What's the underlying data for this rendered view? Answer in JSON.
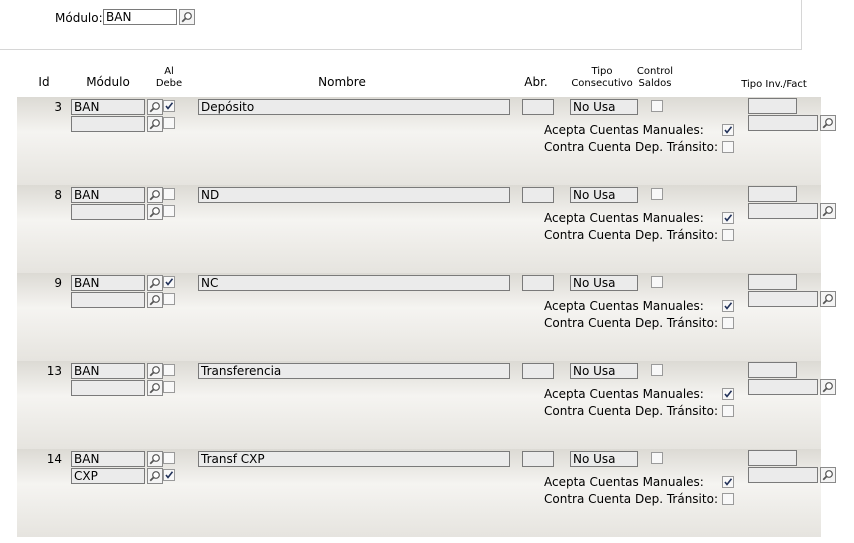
{
  "filter": {
    "module_label": "Módulo:",
    "module_value": "BAN"
  },
  "headers": {
    "id": "Id",
    "modulo": "Módulo",
    "al_debe_1": "Al",
    "al_debe_2": "Debe",
    "nombre": "Nombre",
    "abr": "Abr.",
    "tipo_consec_1": "Tipo",
    "tipo_consec_2": "Consecutivo",
    "control_saldos_1": "Control",
    "control_saldos_2": "Saldos",
    "tipo_inv_fact": "Tipo Inv./Fact"
  },
  "labels": {
    "acepta_cuentas_manuales": "Acepta Cuentas Manuales:",
    "contra_cuenta_dep_transito": "Contra Cuenta Dep. Tránsito:"
  },
  "rows": [
    {
      "id": "3",
      "modulo1": "BAN",
      "modulo2": "",
      "al_debe1": true,
      "al_debe2": false,
      "nombre": "Depósito",
      "abr": "",
      "tipo_consecutivo": "No Usa",
      "control_saldos": false,
      "acepta_manuales": true,
      "contra_cuenta": false
    },
    {
      "id": "8",
      "modulo1": "BAN",
      "modulo2": "",
      "al_debe1": false,
      "al_debe2": false,
      "nombre": "ND",
      "abr": "",
      "tipo_consecutivo": "No Usa",
      "control_saldos": false,
      "acepta_manuales": true,
      "contra_cuenta": false
    },
    {
      "id": "9",
      "modulo1": "BAN",
      "modulo2": "",
      "al_debe1": true,
      "al_debe2": false,
      "nombre": "NC",
      "abr": "",
      "tipo_consecutivo": "No Usa",
      "control_saldos": false,
      "acepta_manuales": true,
      "contra_cuenta": false
    },
    {
      "id": "13",
      "modulo1": "BAN",
      "modulo2": "",
      "al_debe1": false,
      "al_debe2": false,
      "nombre": "Transferencia",
      "abr": "",
      "tipo_consecutivo": "No Usa",
      "control_saldos": false,
      "acepta_manuales": true,
      "contra_cuenta": false
    },
    {
      "id": "14",
      "modulo1": "BAN",
      "modulo2": "CXP",
      "al_debe1": false,
      "al_debe2": true,
      "nombre": "Transf CXP",
      "abr": "",
      "tipo_consecutivo": "No Usa",
      "control_saldos": false,
      "acepta_manuales": true,
      "contra_cuenta": false
    }
  ],
  "icons": {
    "lookup": "magnifier-icon",
    "check": "checkmark-icon"
  }
}
